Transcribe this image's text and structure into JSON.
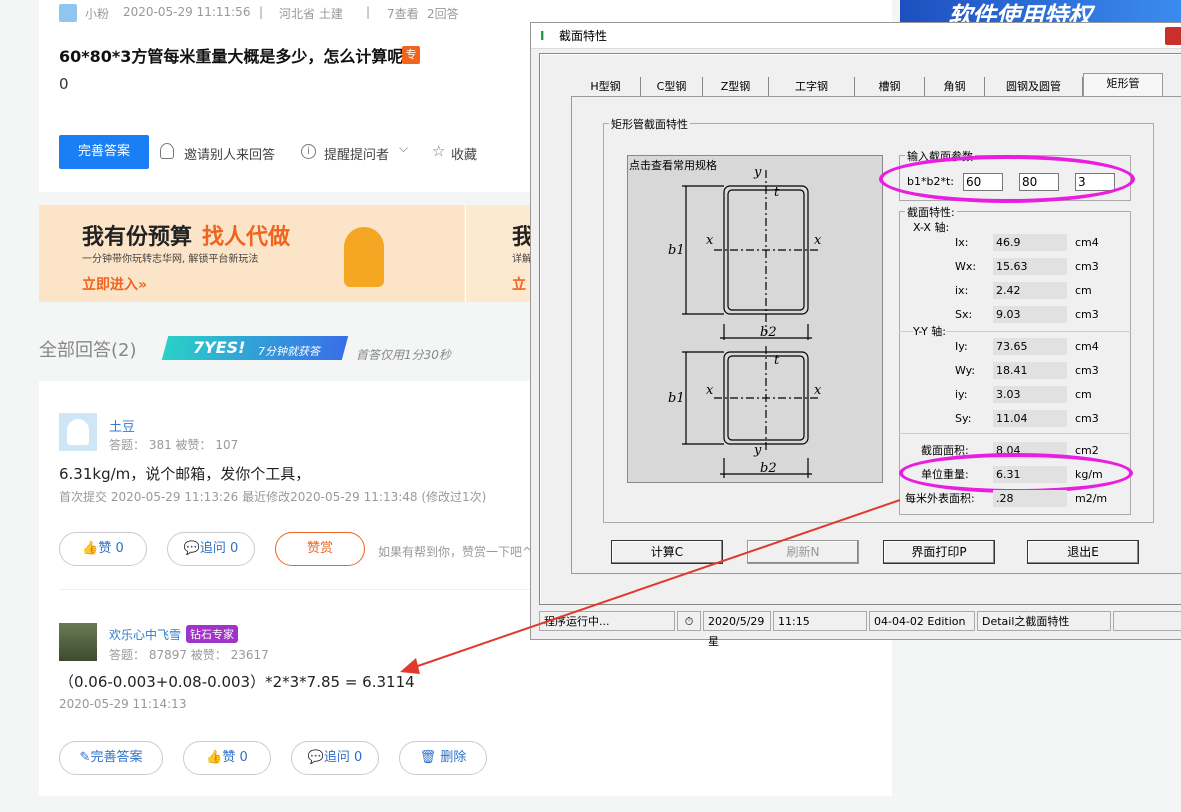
{
  "question": {
    "author": "小粉",
    "date": "2020-05-29 11:11:56",
    "location": "河北省 土建",
    "views": "7查看",
    "answers": "2回答",
    "title": "60*80*3方管每米重量大概是多少，怎么计算呢",
    "tag": "专",
    "body": "0",
    "btn_answer": "完善答案",
    "invite": "邀请别人来回答",
    "remind": "提醒提问者",
    "collect": "收藏"
  },
  "banner": {
    "line1a": "我有份预算",
    "line1b": "找人代做",
    "line2": "一分钟带你玩转志华网, 解锁平台新玩法",
    "cta": "立即进入»",
    "right_partial": "我",
    "right_partial2": "详解",
    "right_partial3": "立"
  },
  "answers_header": {
    "title": "全部回答(2)",
    "badge_big": "7YES!",
    "badge_small": "7分钟就获答",
    "note": "首答仅用1分30秒"
  },
  "answer1": {
    "name": "土豆",
    "stats": "答题： 381    被赞： 107",
    "text": "6.31kg/m，说个邮箱，发你个工具，",
    "meta": "首次提交 2020-05-29 11:13:26  最近修改2020-05-29 11:13:48 (修改过1次)",
    "like": "赞 0",
    "follow": "追问  0",
    "reward": "赞赏",
    "hint": "如果有帮到你，赞赏一下吧^"
  },
  "answer2": {
    "name": "欢乐心中飞雪",
    "badge": "钻石专家",
    "stats": "答题： 87897    被赞： 23617",
    "text": "（0.06-0.003+0.08-0.003）*2*3*7.85 = 6.3114",
    "date": "2020-05-29 11:14:13",
    "improve": "完善答案",
    "like": "赞 0",
    "follow": "追问  0",
    "delete": "删除"
  },
  "ad_right": "软件使用特权",
  "dialog": {
    "title": "截面特性",
    "tabs": [
      "H型钢",
      "C型钢",
      "Z型钢",
      "工字钢",
      "槽钢",
      "角钢",
      "圆钢及圆管",
      "矩形管"
    ],
    "group_title": "矩形管截面特性",
    "diagram_label": "点击查看常用规格",
    "input_group": "输入截面参数",
    "input_label": "b1*b2*t:",
    "inputs": [
      "60",
      "80",
      "3"
    ],
    "props_group": "截面特性:",
    "xx": "X-X 轴:",
    "yy": "Y-Y 轴:",
    "rows_x": [
      {
        "k": "Ix:",
        "v": "46.9",
        "u": "cm4"
      },
      {
        "k": "Wx:",
        "v": "15.63",
        "u": "cm3"
      },
      {
        "k": "ix:",
        "v": "2.42",
        "u": "cm"
      },
      {
        "k": "Sx:",
        "v": "9.03",
        "u": "cm3"
      }
    ],
    "rows_y": [
      {
        "k": "Iy:",
        "v": "73.65",
        "u": "cm4"
      },
      {
        "k": "Wy:",
        "v": "18.41",
        "u": "cm3"
      },
      {
        "k": "iy:",
        "v": "3.03",
        "u": "cm"
      },
      {
        "k": "Sy:",
        "v": "11.04",
        "u": "cm3"
      }
    ],
    "area_label": "截面面积:",
    "area_val": "8.04",
    "area_unit": "cm2",
    "weight_label": "单位重量:",
    "weight_val": "6.31",
    "weight_unit": "kg/m",
    "surface_label": "每米外表面积:",
    "surface_val": ".28",
    "surface_unit": "m2/m",
    "btn_calc": "计算C",
    "btn_refresh": "刷新N",
    "btn_print": "界面打印P",
    "btn_exit": "退出E",
    "status": [
      "程序运行中...",
      "2020/5/29星",
      "11:15",
      "04-04-02 Edition",
      "Detail之截面特性"
    ],
    "diag_labels": {
      "y": "y",
      "x": "x",
      "b1": "b1",
      "b2": "b2",
      "t": "t"
    }
  },
  "colors": {
    "accent": "#1a7ff4",
    "highlight": "#e81ee0",
    "arrow": "#e03a2f",
    "orange": "#f0641e"
  }
}
